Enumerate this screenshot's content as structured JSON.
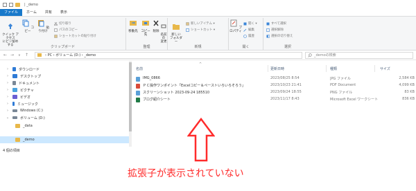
{
  "window": {
    "title": "| _demo"
  },
  "tabs": [
    "ファイル",
    "ホーム",
    "共有",
    "表示"
  ],
  "ribbon": {
    "clipboard": {
      "pin_label": "クイック アクセス\nにピン留めする",
      "copy_label": "コピー",
      "paste_label": "貼り付け",
      "cut_label": "切り取り",
      "copy_path_label": "パスのコピー",
      "paste_shortcut_label": "ショートカットの貼り付け",
      "group_label": "クリップボード"
    },
    "organize": {
      "move_label": "移動先",
      "copyto_label": "コピー先",
      "delete_label": "削除",
      "rename_label": "名前の\n変更",
      "group_label": "整理"
    },
    "new": {
      "new_folder_label": "新しい\nフォルダー",
      "new_item_label": "新しいアイテム ▾",
      "shortcut_label": "ショートカット ▾",
      "group_label": "新規"
    },
    "open": {
      "properties_label": "プロパティ",
      "open_label": "開く ▾",
      "edit_label": "編集",
      "history_label": "履歴",
      "group_label": "開く"
    },
    "select": {
      "select_all_label": "すべて選択",
      "select_none_label": "選択解除",
      "invert_label": "選択の切り替え",
      "group_label": "選択"
    }
  },
  "address": {
    "back": "←",
    "forward": "→",
    "recent": "∨",
    "up": "↑",
    "path": "›  PC  ›  ボリューム (D:)  ›  _demo",
    "search_placeholder": "_demoの検索"
  },
  "nav": {
    "items": [
      {
        "label": "ダウンロード",
        "color": "#2f7bd6"
      },
      {
        "label": "デスクトップ",
        "color": "#2f7bd6"
      },
      {
        "label": "ドキュメント",
        "color": "#7a8796"
      },
      {
        "label": "ピクチャ",
        "color": "#4aa3df"
      },
      {
        "label": "ビデオ",
        "color": "#6b5fd3"
      },
      {
        "label": "ミュージック",
        "color": "#2f7bd6"
      },
      {
        "label": "Windows (C:)",
        "color": "#7a8796"
      },
      {
        "label": "ボリューム (D:)",
        "color": "#7a8796"
      },
      {
        "label": "_data",
        "color": "#e8b84a"
      },
      {
        "label": "_demo",
        "color": "#e8b84a"
      }
    ],
    "status": "4 個の項目"
  },
  "columns": {
    "name": "名前",
    "date": "更新日時",
    "type": "種類",
    "size": "サイズ"
  },
  "files": [
    {
      "name": "IMG_0866",
      "date": "2023/08/25 8:54",
      "type": "JPG ファイル",
      "size": "2,584 KB",
      "icon_color": "#5aa0d8"
    },
    {
      "name": "ＰＣ操作ワンポイント「Excelコピー＆ペーストいろいろそろう」",
      "date": "2023/10/23 21:41",
      "type": "PDF Document",
      "size": "4,099 KB",
      "icon_color": "#d94b3a"
    },
    {
      "name": "スクリーンショット 2023-09-24 185510",
      "date": "2023/09/24 18:55",
      "type": "PNG ファイル",
      "size": "83 KB",
      "icon_color": "#5aa0d8"
    },
    {
      "name": "ブログ紹介シート",
      "date": "2023/11/17 8:43",
      "type": "Microsoft Excel ワークシート",
      "size": "836 KB",
      "icon_color": "#1f7a45"
    }
  ],
  "annotation": {
    "caption": "拡張子が表示されていない",
    "color": "#ff2b2b"
  }
}
